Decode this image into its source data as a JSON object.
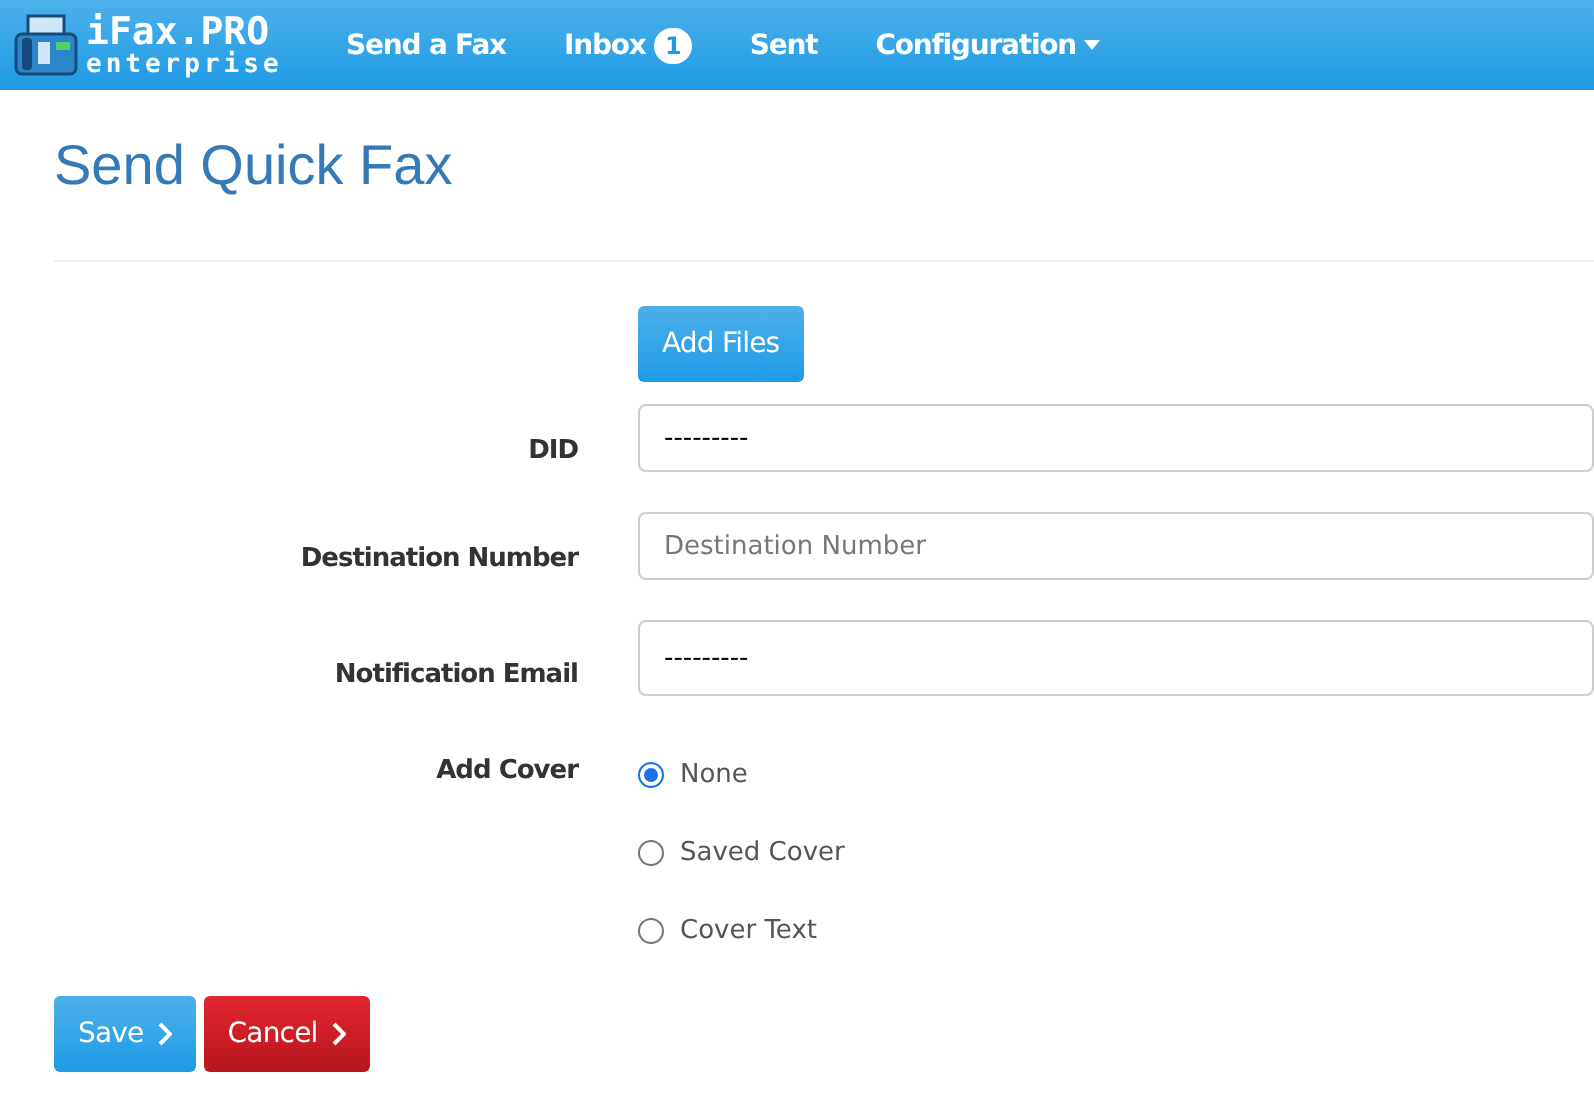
{
  "brand": {
    "name": "iFax.PRO",
    "subtitle": "enterprise"
  },
  "nav": [
    {
      "label": "Send a Fax",
      "kind": "link"
    },
    {
      "label": "Inbox",
      "kind": "badge",
      "badge": "1"
    },
    {
      "label": "Sent",
      "kind": "link"
    },
    {
      "label": "Configuration",
      "kind": "dropdown"
    }
  ],
  "title": "Send Quick Fax",
  "add_files": "Add Files",
  "fields": [
    {
      "label": "DID",
      "kind": "select",
      "value": "---------"
    },
    {
      "label": "Destination Number",
      "kind": "input",
      "placeholder": "Destination Number"
    },
    {
      "label": "Notification Email",
      "kind": "select",
      "value": "---------"
    }
  ],
  "cover": {
    "label": "Add Cover",
    "options": [
      {
        "label": "None",
        "selected": true
      },
      {
        "label": "Saved Cover",
        "selected": false
      },
      {
        "label": "Cover Text",
        "selected": false
      }
    ]
  },
  "buttons": [
    {
      "label": "Save",
      "kind": "primary"
    },
    {
      "label": "Cancel",
      "kind": "danger"
    }
  ]
}
